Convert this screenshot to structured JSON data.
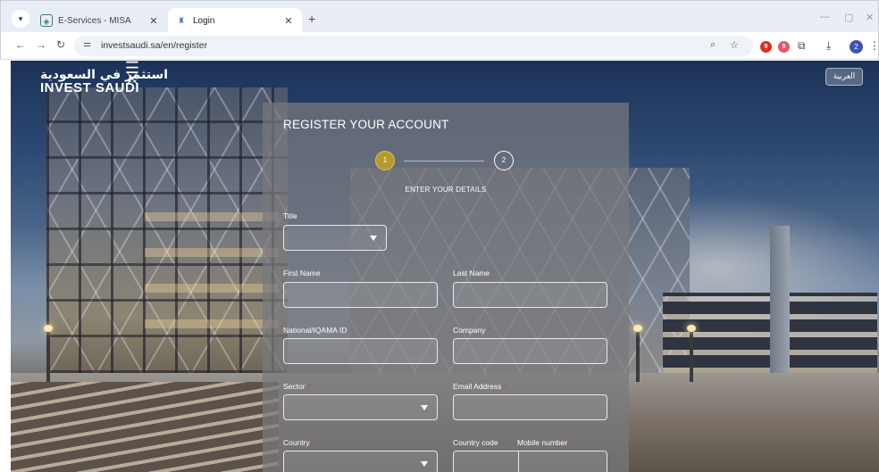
{
  "browser": {
    "tabs": [
      {
        "title": "E-Services - MISA",
        "active": false
      },
      {
        "title": "Login",
        "active": true
      }
    ],
    "url": "investsaudi.sa/en/register",
    "profile_initial": "2",
    "extension_badges": [
      "9",
      "9"
    ]
  },
  "site": {
    "logo_arabic": "استثمر في السعودية",
    "logo_english": "INVEST SAUDI",
    "language_button": "العربية"
  },
  "form": {
    "title": "REGISTER YOUR ACCOUNT",
    "steps": [
      "1",
      "2"
    ],
    "active_step": 1,
    "step_caption": "ENTER YOUR DETAILS",
    "fields": {
      "title": {
        "label": "Title",
        "required": true,
        "value": ""
      },
      "first_name": {
        "label": "First Name",
        "required": true,
        "value": ""
      },
      "last_name": {
        "label": "Last Name",
        "required": true,
        "value": ""
      },
      "national_id": {
        "label": "National/IQAMA ID",
        "required": false,
        "value": ""
      },
      "company": {
        "label": "Company",
        "required": true,
        "value": ""
      },
      "sector": {
        "label": "Sector",
        "required": true,
        "value": ""
      },
      "email": {
        "label": "Email Address",
        "required": true,
        "value": ""
      },
      "country": {
        "label": "Country",
        "required": true,
        "value": ""
      },
      "country_code": {
        "label": "Country code",
        "required": false,
        "value": ""
      },
      "mobile": {
        "label": "Mobile number",
        "required": true,
        "value": ""
      }
    },
    "required_marker": "*"
  },
  "colors": {
    "step_active": "#b59a2e",
    "required": "#d3452f",
    "panel": "#78787d"
  }
}
